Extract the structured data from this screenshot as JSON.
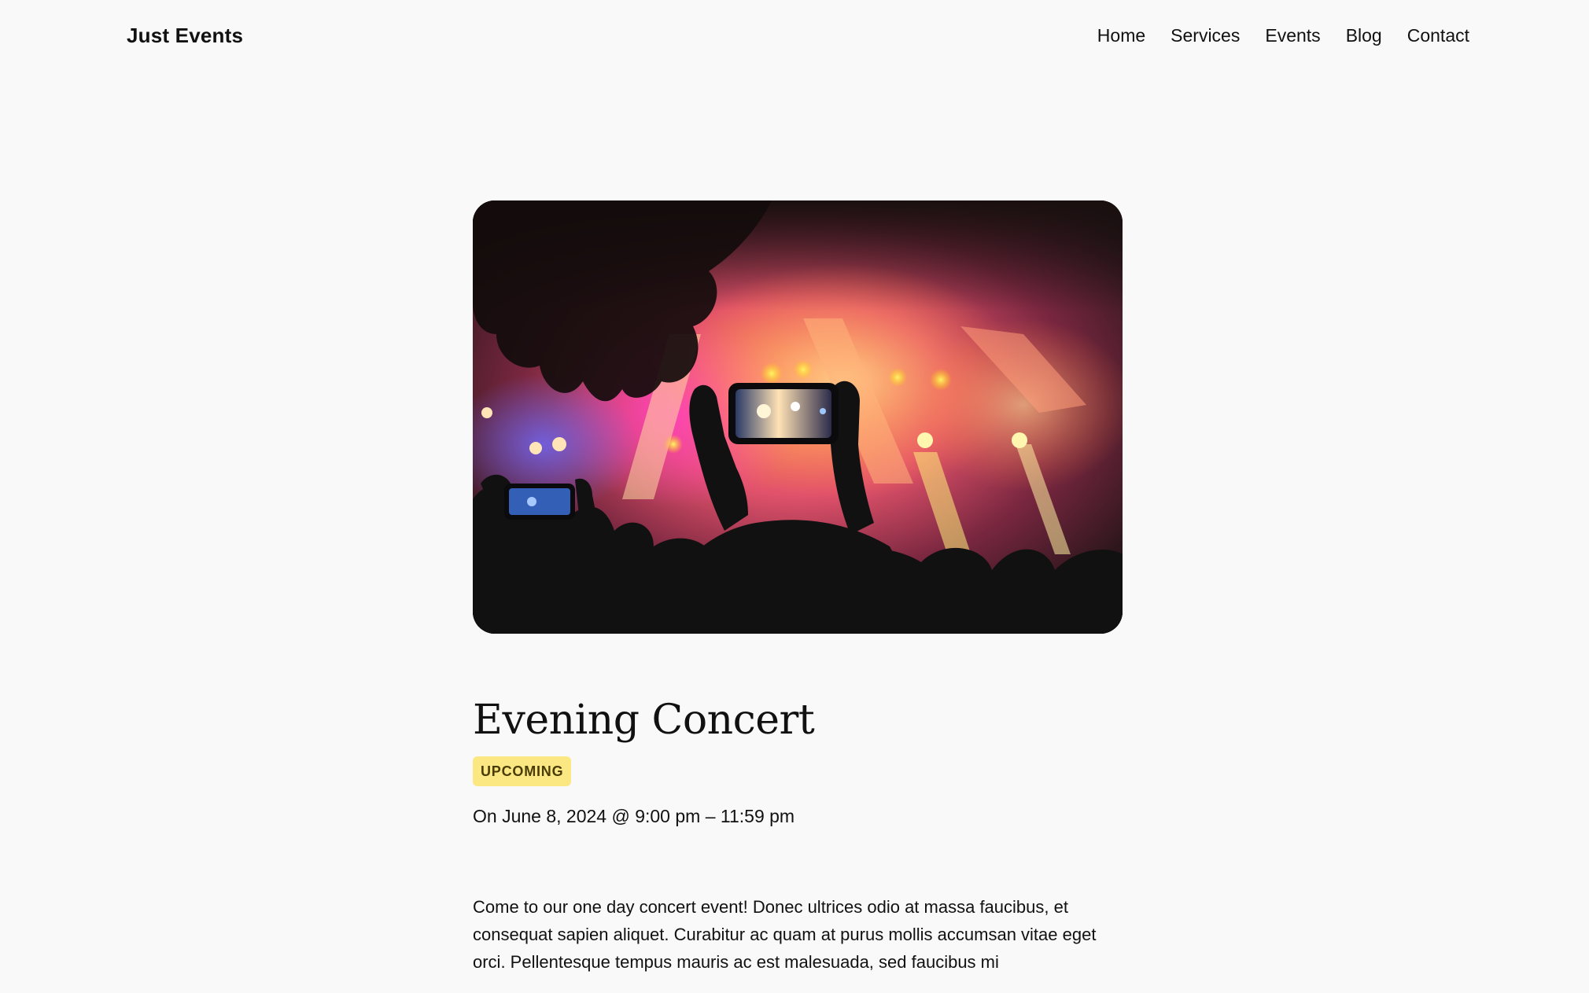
{
  "header": {
    "site_title": "Just Events",
    "nav": [
      "Home",
      "Services",
      "Events",
      "Blog",
      "Contact"
    ]
  },
  "event": {
    "title": "Evening Concert",
    "status": "UPCOMING",
    "date_line": "On June 8, 2024 @ 9:00 pm – 11:59 pm",
    "description": "Come to our one day concert event! Donec ultrices odio at massa faucibus, et consequat sapien aliquet. Curabitur ac quam at purus mollis accumsan vitae eget orci. Pellentesque tempus mauris ac est malesuada, sed faucibus mi"
  },
  "colors": {
    "background": "#f9f9f9",
    "badge_bg": "#fce883",
    "badge_text": "#4a3c06",
    "text": "#111111"
  },
  "image": {
    "subject": "concert-crowd-phone-photo"
  }
}
